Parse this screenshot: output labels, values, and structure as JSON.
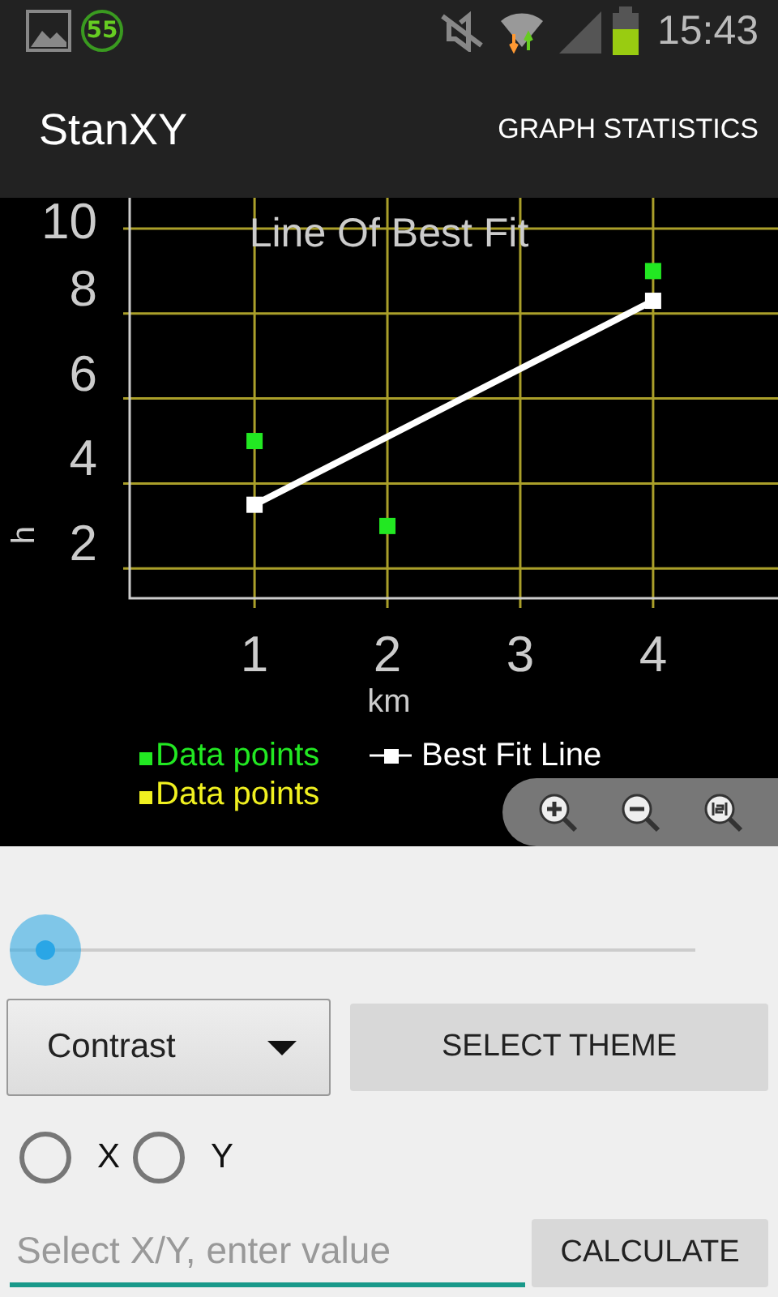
{
  "status_bar": {
    "notification_badge": "55",
    "time": "15:43"
  },
  "action_bar": {
    "title": "StanXY",
    "action": "GRAPH STATISTICS"
  },
  "graph": {
    "chart_data": {
      "type": "scatter",
      "title": "Line Of Best Fit",
      "xlabel": "km",
      "ylabel": "h",
      "xlim": [
        0.06,
        4.94
      ],
      "ylim": [
        1.3,
        10.8
      ],
      "xticks": [
        1,
        2,
        3,
        4
      ],
      "yticks": [
        2,
        4,
        6,
        8,
        10
      ],
      "grid": true,
      "legend": true,
      "series": [
        {
          "name": "Data points",
          "color": "#22e822",
          "type": "scatter",
          "x": [
            1,
            2,
            4
          ],
          "values": [
            5,
            3,
            9
          ]
        },
        {
          "name": "Best Fit Line",
          "color": "#ffffff",
          "type": "line",
          "marker": "square",
          "x": [
            1,
            4
          ],
          "values": [
            3.5,
            8.3
          ]
        },
        {
          "name": "Data points",
          "color": "#f0f020",
          "type": "scatter",
          "values": [
            null,
            null,
            null
          ]
        }
      ]
    },
    "zoom_controls": [
      {
        "kind": "zoom-in"
      },
      {
        "kind": "zoom-out"
      },
      {
        "kind": "reset"
      }
    ]
  },
  "theme": {
    "dropdown": "Contrast",
    "button": "SELECT THEME"
  },
  "axis_choice": [
    {
      "label": "X",
      "selected": false
    },
    {
      "label": "Y",
      "selected": false
    }
  ],
  "input": {
    "placeholder": "Select X/Y, enter value"
  },
  "calculate_button": "CALCULATE"
}
